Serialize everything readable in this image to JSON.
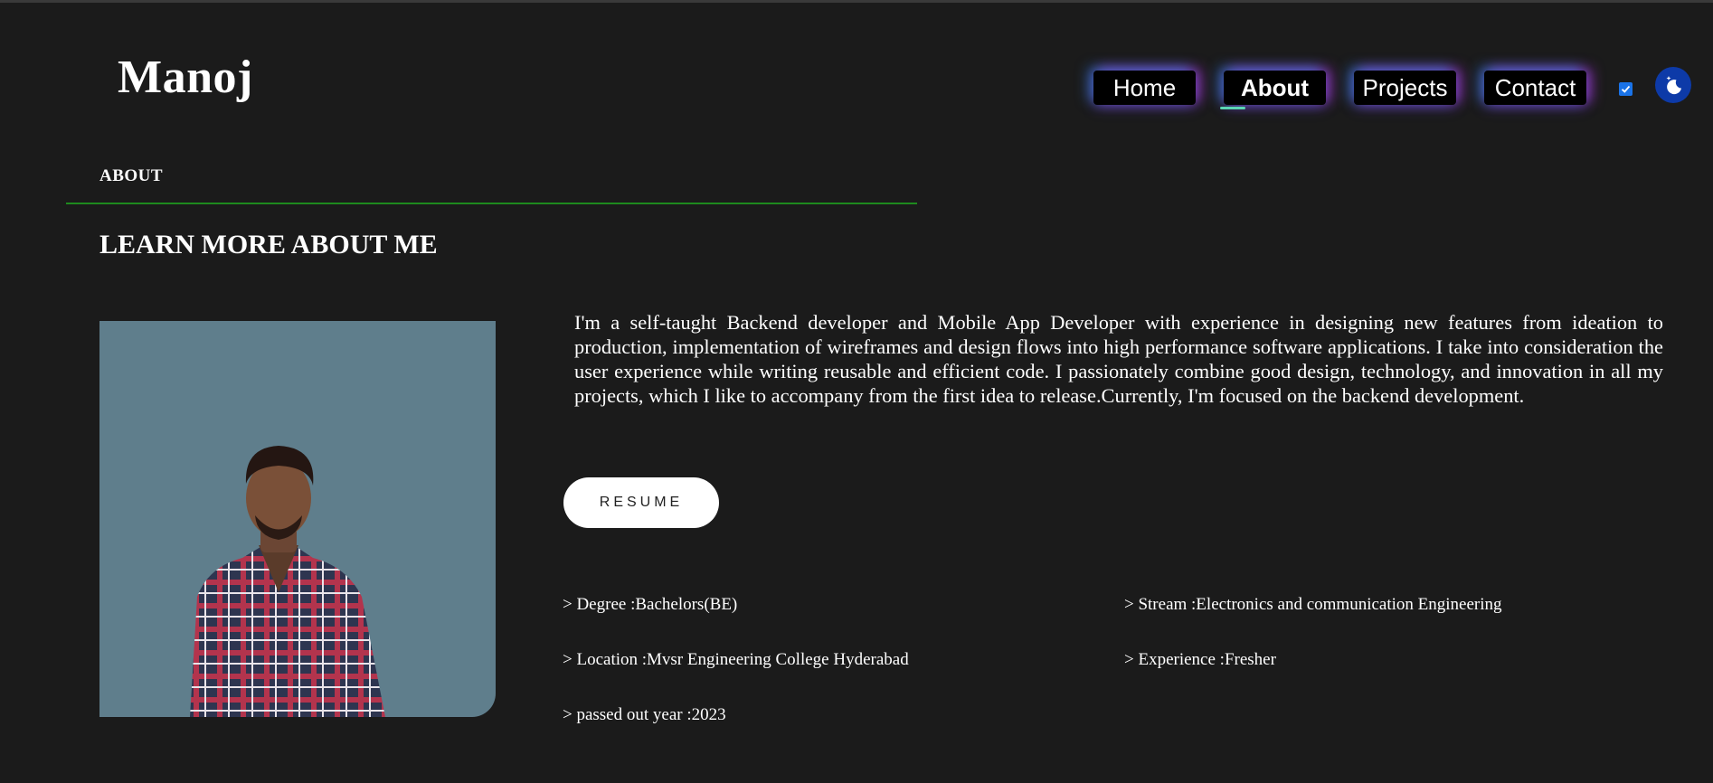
{
  "brand": {
    "name": "Manoj"
  },
  "nav": {
    "items": [
      {
        "label": "Home"
      },
      {
        "label": "About"
      },
      {
        "label": "Projects"
      },
      {
        "label": "Contact"
      }
    ],
    "active": "About",
    "theme_checkbox_checked": true,
    "theme_icon": "moon-icon"
  },
  "about": {
    "section_label": "ABOUT",
    "heading": "LEARN MORE ABOUT ME",
    "bio": "I'm a self-taught Backend developer and Mobile App Developer with experience in designing new features from ideation to production, implementation of wireframes and design flows into high performance software applications. I take into consideration the user experience while writing reusable and efficient code. I passionately combine good design, technology, and innovation in all my projects, which I like to accompany from the first idea to release.Currently, I'm focused on the backend development.",
    "resume_label": "RESUME",
    "facts": {
      "degree": "> Degree :Bachelors(BE)",
      "stream": "> Stream :Electronics and communication Engineering",
      "location": "> Location :Mvsr Engineering College Hyderabad",
      "experience": "> Experience :Fresher",
      "passed_out": "> passed out year :2023"
    }
  },
  "colors": {
    "background": "#1b1b1b",
    "rule": "#1e8a1e",
    "photo_bg": "#5f7e8c",
    "toggle": "#0d3aa8",
    "underline": "#5ad6b4"
  }
}
